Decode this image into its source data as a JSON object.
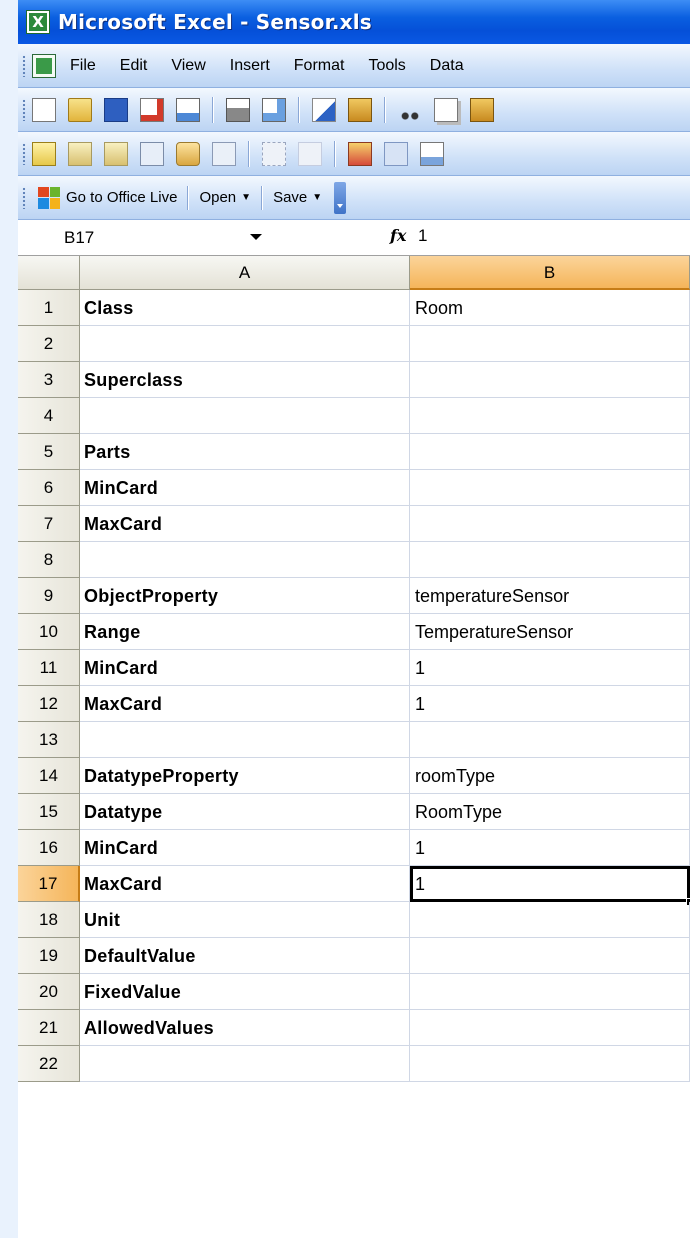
{
  "window": {
    "title": "Microsoft Excel - Sensor.xls"
  },
  "menu": [
    "File",
    "Edit",
    "View",
    "Insert",
    "Format",
    "Tools",
    "Data"
  ],
  "toolbar3": {
    "office_live": "Go to Office Live",
    "open": "Open",
    "save": "Save"
  },
  "formula_bar": {
    "name_box": "B17",
    "fx": "fx",
    "value": "1"
  },
  "columns": [
    "A",
    "B"
  ],
  "selected_cell": "B17",
  "rows": [
    {
      "n": "1",
      "a": "Class",
      "b": "Room"
    },
    {
      "n": "2",
      "a": "",
      "b": ""
    },
    {
      "n": "3",
      "a": "Superclass",
      "b": ""
    },
    {
      "n": "4",
      "a": "",
      "b": ""
    },
    {
      "n": "5",
      "a": "Parts",
      "b": ""
    },
    {
      "n": "6",
      "a": "MinCard",
      "b": ""
    },
    {
      "n": "7",
      "a": "MaxCard",
      "b": ""
    },
    {
      "n": "8",
      "a": "",
      "b": ""
    },
    {
      "n": "9",
      "a": "ObjectProperty",
      "b": "temperatureSensor"
    },
    {
      "n": "10",
      "a": "Range",
      "b": "TemperatureSensor"
    },
    {
      "n": "11",
      "a": "MinCard",
      "b": "1"
    },
    {
      "n": "12",
      "a": "MaxCard",
      "b": "1"
    },
    {
      "n": "13",
      "a": "",
      "b": ""
    },
    {
      "n": "14",
      "a": "DatatypeProperty",
      "b": "roomType"
    },
    {
      "n": "15",
      "a": "Datatype",
      "b": "RoomType"
    },
    {
      "n": "16",
      "a": "MinCard",
      "b": "1"
    },
    {
      "n": "17",
      "a": "MaxCard",
      "b": "1"
    },
    {
      "n": "18",
      "a": "Unit",
      "b": ""
    },
    {
      "n": "19",
      "a": "DefaultValue",
      "b": ""
    },
    {
      "n": "20",
      "a": "FixedValue",
      "b": ""
    },
    {
      "n": "21",
      "a": "AllowedValues",
      "b": ""
    },
    {
      "n": "22",
      "a": "",
      "b": ""
    }
  ]
}
